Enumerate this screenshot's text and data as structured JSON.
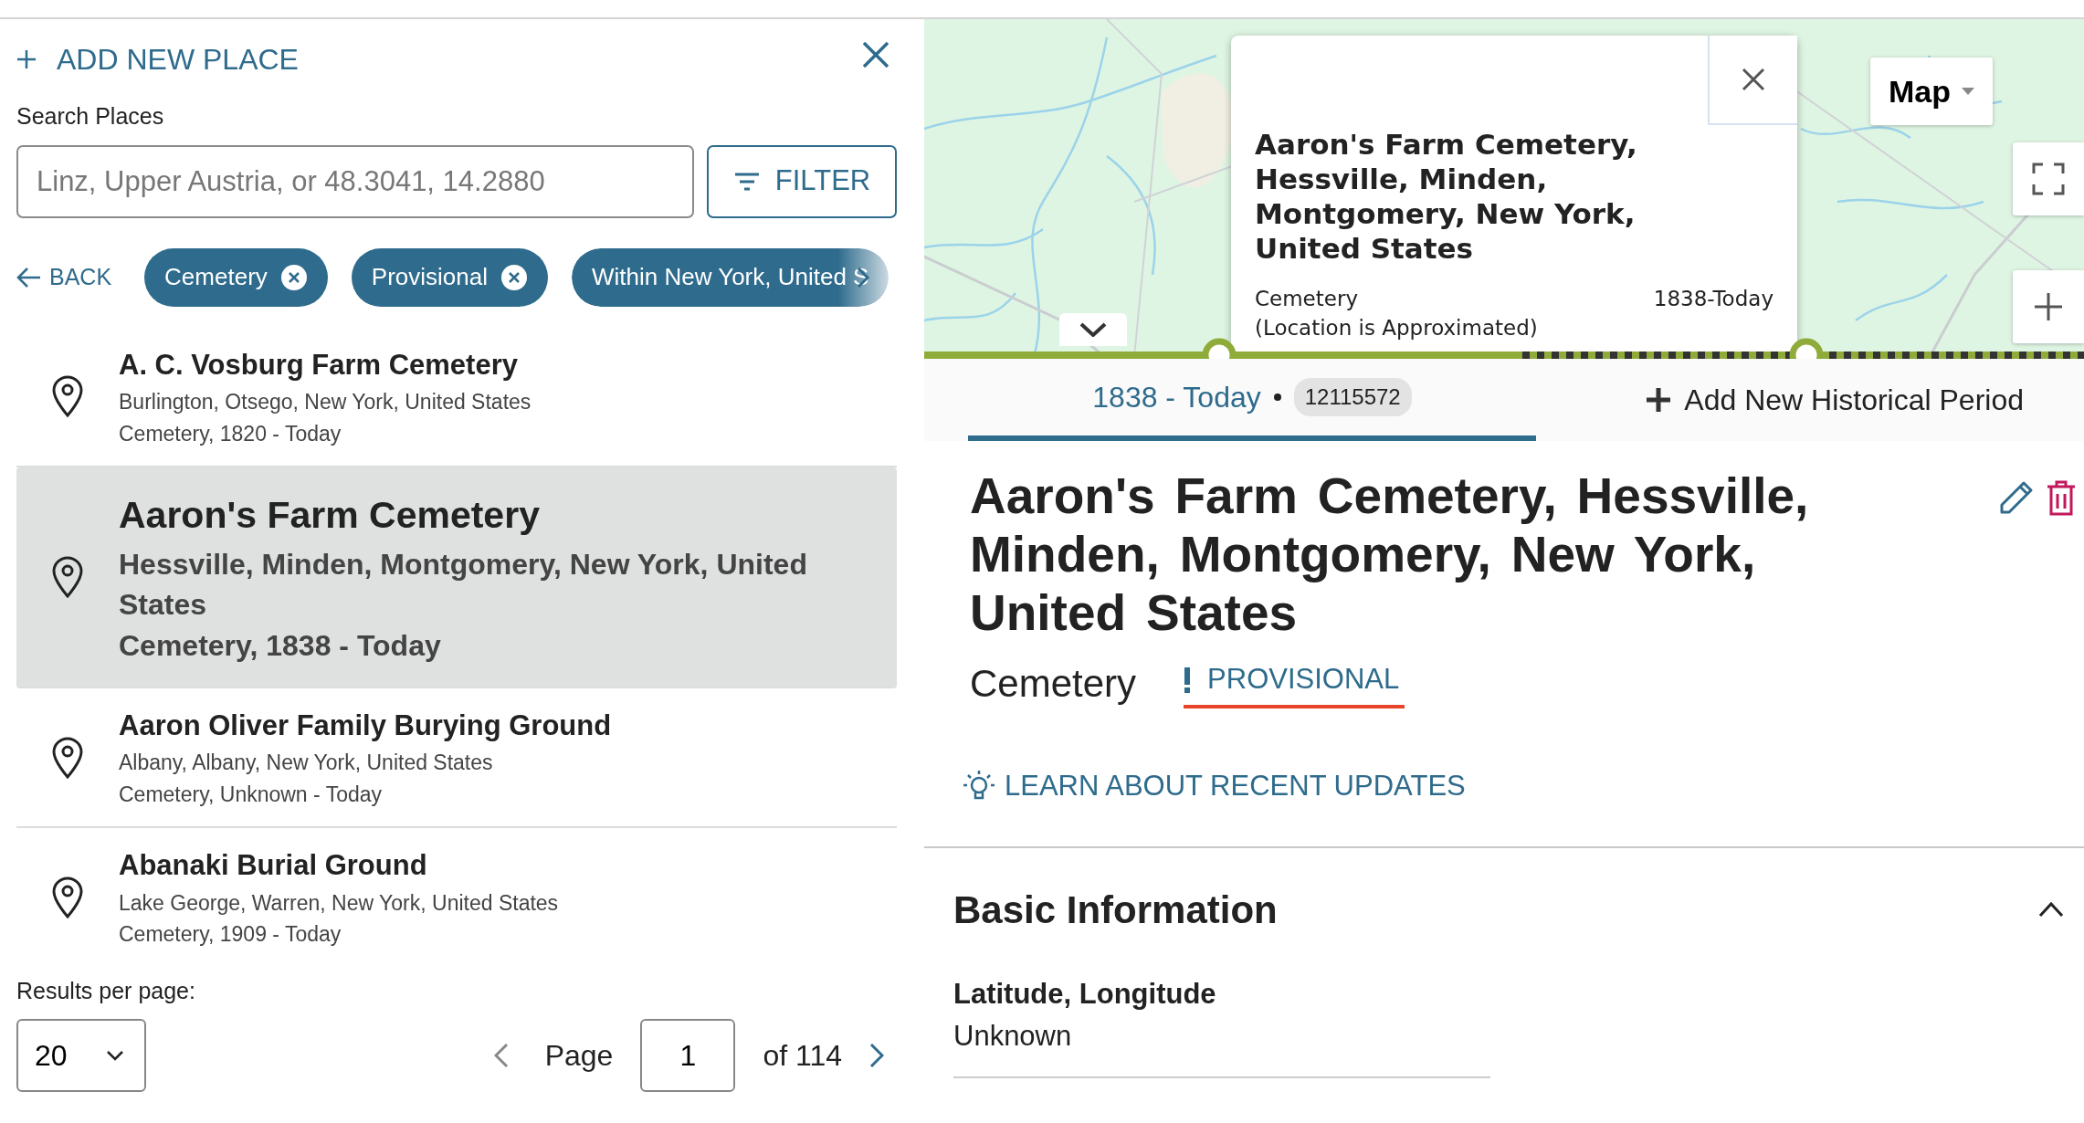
{
  "panel": {
    "add_label": "ADD NEW PLACE"
  },
  "search": {
    "label": "Search Places",
    "placeholder": "Linz, Upper Austria, or 48.3041, 14.2880",
    "filter_label": "FILTER"
  },
  "back_label": "BACK",
  "chips": [
    {
      "label": "Cemetery",
      "removable": true
    },
    {
      "label": "Provisional",
      "removable": true
    },
    {
      "label": "Within New York, United S",
      "removable": false
    }
  ],
  "results": [
    {
      "name": "A. C. Vosburg Farm Cemetery",
      "place": "Burlington, Otsego, New York, United States",
      "detail": "Cemetery, 1820 - Today",
      "selected": false
    },
    {
      "name": "Aaron's Farm Cemetery",
      "place": "Hessville, Minden, Montgomery, New York, United States",
      "detail": "Cemetery, 1838 - Today",
      "selected": true
    },
    {
      "name": "Aaron Oliver Family Burying Ground",
      "place": "Albany, Albany, New York, United States",
      "detail": "Cemetery, Unknown - Today",
      "selected": false
    },
    {
      "name": "Abanaki Burial Ground",
      "place": "Lake George, Warren, New York, United States",
      "detail": "Cemetery, 1909 - Today",
      "selected": false
    }
  ],
  "pagination": {
    "per_page_label": "Results per page:",
    "per_page": "20",
    "page_label": "Page",
    "page": "1",
    "total": "of 114"
  },
  "map": {
    "type_label": "Map"
  },
  "popup": {
    "title": "Aaron's Farm Cemetery, Hessville, Minden, Montgomery, New York, United States",
    "type": "Cemetery",
    "period": "1838-Today",
    "note": "(Location is Approximated)"
  },
  "periods": [
    {
      "label": "1838 - Today",
      "id": "12115572",
      "selected": true
    }
  ],
  "add_period_label": "Add New Historical Period",
  "place": {
    "title": "Aaron's Farm Cemetery, Hessville, Minden, Montgomery, New York, United States",
    "type": "Cemetery",
    "status": "PROVISIONAL",
    "learn_label": "LEARN ABOUT RECENT UPDATES"
  },
  "basic_info": {
    "heading": "Basic Information",
    "expanded": true,
    "fields": [
      {
        "label": "Latitude, Longitude",
        "value": "Unknown"
      }
    ]
  }
}
